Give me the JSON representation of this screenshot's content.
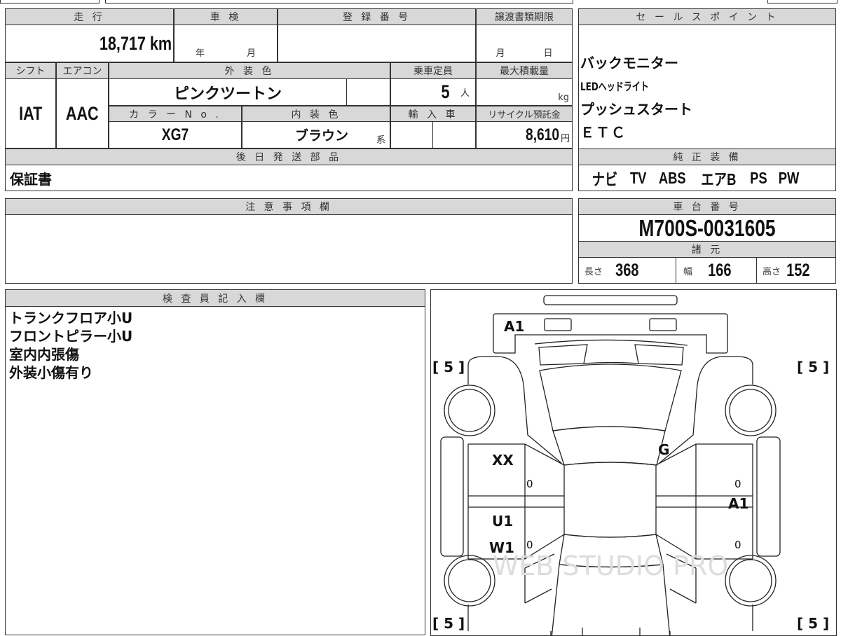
{
  "vehicle": {
    "headers": {
      "mileage": "走 行",
      "shaken": "車 検",
      "registration": "登 録 番 号",
      "transfer_deadline": "譲渡書類期限",
      "shift": "シフト",
      "aircon": "エアコン",
      "exterior_color": "外 装 色",
      "capacity": "乗車定員",
      "max_load": "最大積載量",
      "color_no": "カ ラ ー N o .",
      "interior_color": "内 装 色",
      "import": "輸 入 車",
      "recycle": "リサイクル預託金",
      "later_parts": "後 日 発 送 部 品"
    },
    "mileage": "18,717 km",
    "shaken_year_unit": "年",
    "shaken_month_unit": "月",
    "transfer_month_unit": "月",
    "transfer_day_unit": "日",
    "shift": "IAT",
    "aircon": "AAC",
    "exterior_color": "ピンクツートン",
    "capacity": "5",
    "capacity_unit": "人",
    "max_load_unit": "kg",
    "color_no": "XG7",
    "interior_color": "ブラウン",
    "interior_suffix": "系",
    "recycle": "8,610",
    "recycle_unit": "円",
    "later_parts": "保証書"
  },
  "sales_points": {
    "header": "セ ー ル ス ポ イ ン ト",
    "items": [
      "バックモニター",
      "LEDヘッドライト",
      "プッシュスタート",
      "ＥＴＣ"
    ]
  },
  "equipment": {
    "header": "純 正 装 備",
    "items": [
      "ナビ",
      "TV",
      "ABS",
      "エアB",
      "PS",
      "PW"
    ]
  },
  "notes": {
    "header": "注 意 事 項 欄"
  },
  "chassis": {
    "header": "車 台 番 号",
    "value": "M700S-0031605"
  },
  "specs": {
    "header": "諸 元",
    "length_label": "長さ",
    "length": "368",
    "width_label": "幅",
    "width": "166",
    "height_label": "高さ",
    "height": "152"
  },
  "inspector": {
    "header": "検 査 員 記 入 欄",
    "items": [
      "トランクフロア小U",
      "フロントピラー小U",
      "室内内張傷",
      "外装小傷有り"
    ]
  },
  "diagram": {
    "marks": {
      "trunk": "A1",
      "pillar": "G",
      "right_side": "A1",
      "left_front_door": "XX",
      "left_rear_1": "U1",
      "left_rear_2": "W1",
      "zero": "0",
      "tire": "[ 5 ]"
    },
    "watermark": "WEB STUDIO PRO"
  }
}
